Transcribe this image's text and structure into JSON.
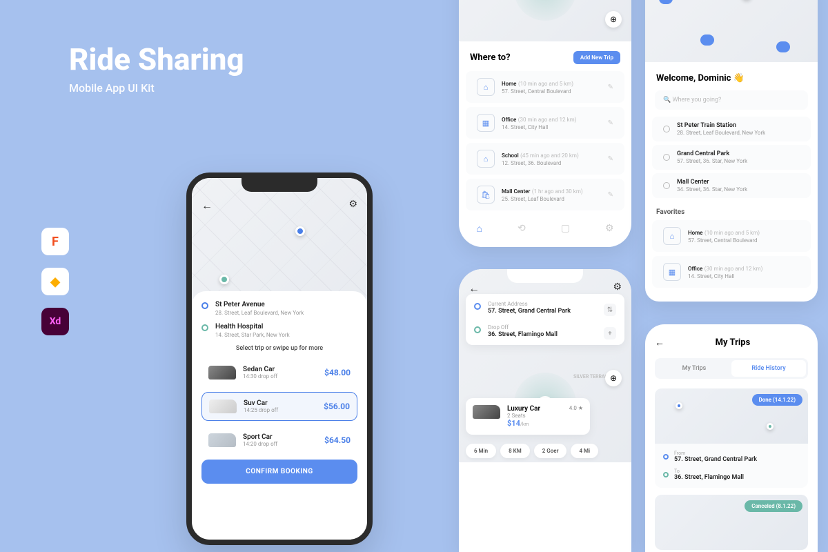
{
  "hero": {
    "title": "Ride Sharing",
    "subtitle": "Mobile App UI Kit"
  },
  "tools": [
    "F",
    "◆",
    "Xd"
  ],
  "colors": {
    "primary": "#5b8def",
    "accent": "#6ab8a8"
  },
  "main_phone": {
    "pickup": {
      "name": "St Peter Avenue",
      "addr": "28. Street, Leaf Boulevard, New York"
    },
    "dropoff": {
      "name": "Health Hospital",
      "addr": "14. Street, Star Park, New York"
    },
    "hint": "Select trip or swipe up for more",
    "cars": [
      {
        "name": "Sedan Car",
        "time": "14:30 drop off",
        "price": "$48.00"
      },
      {
        "name": "Suv Car",
        "time": "14:25 drop off",
        "price": "$56.00"
      },
      {
        "name": "Sport Car",
        "time": "14:20 drop off",
        "price": "$64.50"
      }
    ],
    "confirm": "CONFIRM BOOKING"
  },
  "where_to": {
    "title": "Where to?",
    "add_btn": "Add New Trip",
    "items": [
      {
        "icon": "⌂",
        "name": "Home",
        "meta": "(10 min ago and 5 km)",
        "addr": "57. Street, Central Boulevard"
      },
      {
        "icon": "▦",
        "name": "Office",
        "meta": "(30 min ago and 12 km)",
        "addr": "14. Street, City Hall"
      },
      {
        "icon": "⌂",
        "name": "School",
        "meta": "(45 min ago and 20 km)",
        "addr": "12. Street, 36. Boulevard"
      },
      {
        "icon": "🛍",
        "name": "Mall Center",
        "meta": "(1 hr ago and 30 km)",
        "addr": "25. Street, Leaf Boulevard"
      }
    ]
  },
  "welcome": {
    "greeting": "Welcome, Dominic 👋",
    "search_placeholder": "Where you going?",
    "recents": [
      {
        "name": "St Peter Train Station",
        "addr": "28. Street, Leaf Boulevard, New York"
      },
      {
        "name": "Grand Central Park",
        "addr": "57. Street, 36. Star, New York"
      },
      {
        "name": "Mall Center",
        "addr": "34. Street, 36. Star, New York"
      }
    ],
    "fav_label": "Favorites",
    "favorites": [
      {
        "icon": "⌂",
        "name": "Home",
        "meta": "(10 min ago and 5 km)",
        "addr": "57. Street, Central Boulevard"
      },
      {
        "icon": "▦",
        "name": "Office",
        "meta": "(30 min ago and 12 km)",
        "addr": "14. Street, City Hall"
      }
    ]
  },
  "route": {
    "current_label": "Current Address",
    "current": "57. Street, Grand Central Park",
    "drop_label": "Drop Off",
    "drop": "36. Street, Flamingo Mall",
    "map_label": "SILVER TERRACE",
    "luxury": {
      "name": "Luxury Car",
      "seats": "2 Seats",
      "price": "$14",
      "unit": "/km",
      "rating": "4.0 ★"
    },
    "chips": [
      "6 Min",
      "8 KM",
      "2 Goer",
      "4 Mi"
    ]
  },
  "trips": {
    "title": "My Trips",
    "tabs": [
      "My Trips",
      "Ride History"
    ],
    "card1": {
      "badge": "Done (14.1.22)",
      "from_lbl": "From",
      "from": "57. Street, Grand Central Park",
      "to_lbl": "To",
      "to": "36. Street, Flamingo Mall"
    },
    "card2": {
      "badge": "Canceled (8.1.22)"
    }
  }
}
